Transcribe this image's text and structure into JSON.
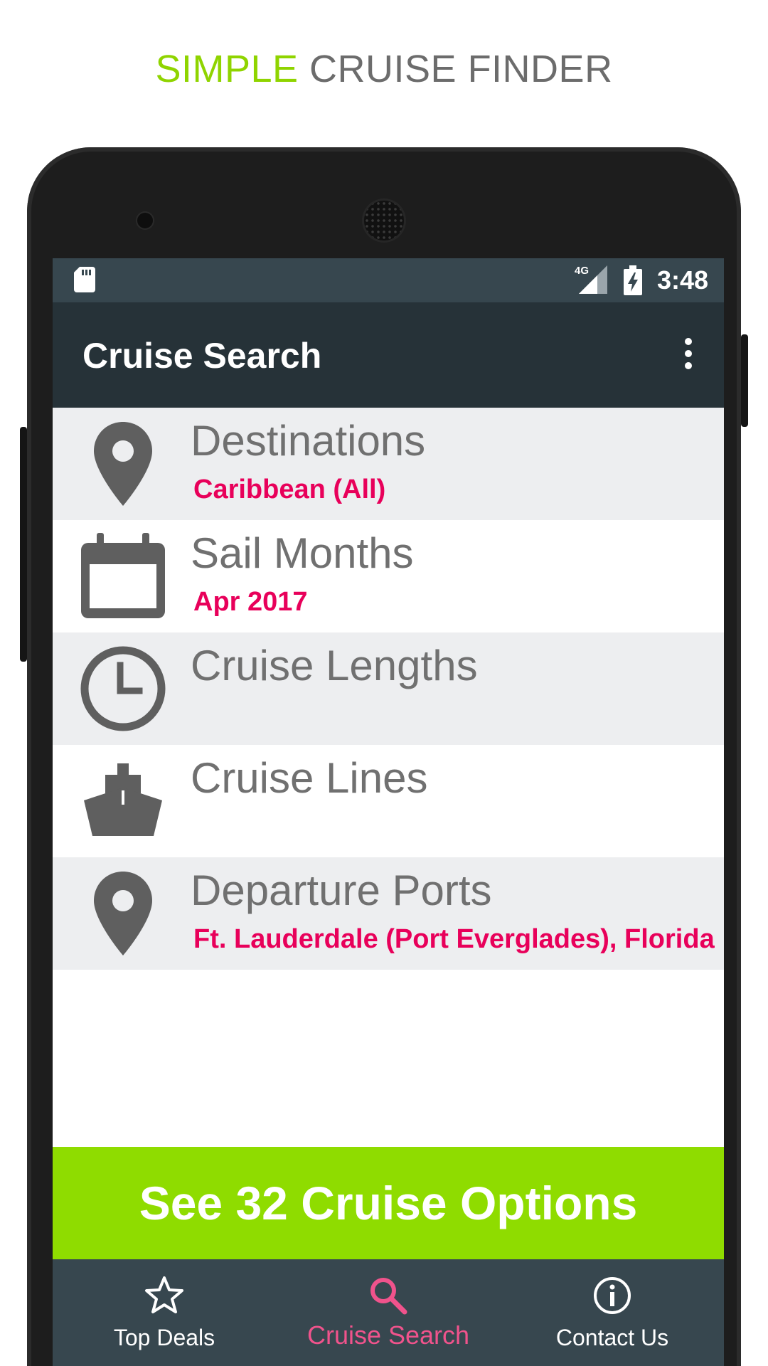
{
  "headline": {
    "accent": "SIMPLE",
    "rest": "CRUISE FINDER"
  },
  "status_bar": {
    "network": "4G",
    "time": "3:48"
  },
  "app_bar": {
    "title": "Cruise Search",
    "menu_icon": "more-vert-icon"
  },
  "search_rows": [
    {
      "icon": "location-pin-icon",
      "title": "Destinations",
      "value": "Caribbean (All)"
    },
    {
      "icon": "calendar-icon",
      "title": "Sail Months",
      "value": "Apr 2017"
    },
    {
      "icon": "clock-icon",
      "title": "Cruise Lengths",
      "value": ""
    },
    {
      "icon": "ship-icon",
      "title": "Cruise Lines",
      "value": ""
    },
    {
      "icon": "location-pin-icon",
      "title": "Departure Ports",
      "value": "Ft. Lauderdale (Port Everglades), Florida"
    }
  ],
  "cta": {
    "label": "See 32 Cruise Options"
  },
  "bottom_nav": {
    "items": [
      {
        "icon": "star-icon",
        "label": "Top Deals",
        "active": false
      },
      {
        "icon": "search-icon",
        "label": "Cruise Search",
        "active": true
      },
      {
        "icon": "info-icon",
        "label": "Contact Us",
        "active": false
      }
    ]
  },
  "colors": {
    "accent_green": "#8fdc00",
    "value_pink": "#e8005a",
    "active_nav_pink": "#f0538c",
    "app_bar": "#263238",
    "status_bar": "#37474f",
    "icon_gray": "#5f5f5f"
  }
}
